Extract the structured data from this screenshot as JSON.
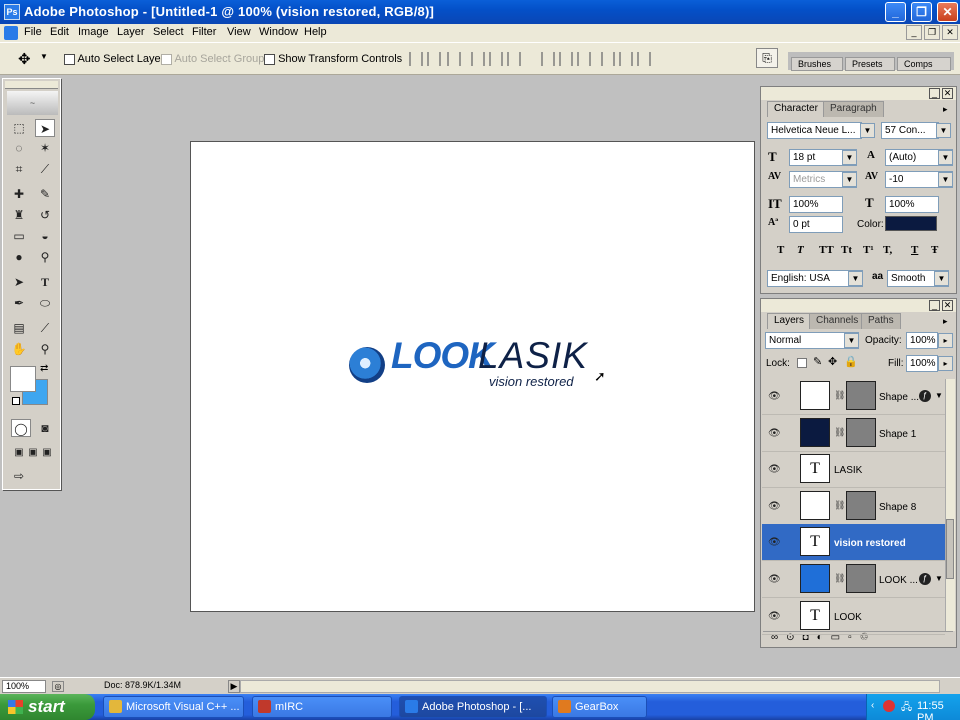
{
  "window": {
    "title": "Adobe Photoshop - [Untitled-1 @ 100% (vision restored, RGB/8)]",
    "app_icon": "Ps",
    "minimize": "_",
    "restore": "❐",
    "close": "✕"
  },
  "menu": {
    "items": [
      "File",
      "Edit",
      "Image",
      "Layer",
      "Select",
      "Filter",
      "View",
      "Window",
      "Help"
    ],
    "doc_minimize": "_",
    "doc_restore": "❐",
    "doc_close": "✕"
  },
  "options_bar": {
    "auto_select_layer": "Auto Select Layer",
    "auto_select_groups": "Auto Select Groups",
    "show_transform_controls": "Show Transform Controls",
    "well_tabs": [
      "Brushes",
      "Presets",
      "Comps"
    ]
  },
  "document": {
    "logo": {
      "look": "LOOK",
      "lasik": "LASIK",
      "tagline": "vision restored"
    }
  },
  "character_panel": {
    "tabs": [
      "Character",
      "Paragraph"
    ],
    "font_family": "Helvetica Neue L...",
    "font_style": "57 Con...",
    "size": "18 pt",
    "leading": "(Auto)",
    "kerning": "Metrics",
    "tracking": "-10",
    "vertical_scale": "100%",
    "horizontal_scale": "100%",
    "baseline_shift": "0 pt",
    "color_label": "Color:",
    "color": "#0b1a40",
    "style_buttons": [
      "T",
      "T",
      "TT",
      "Tt",
      "T¹",
      "T,",
      "T",
      "Ŧ"
    ],
    "language": "English: USA",
    "antialias_icon": "aa",
    "antialias": "Smooth"
  },
  "layers_panel": {
    "tabs": [
      "Layers",
      "Channels",
      "Paths"
    ],
    "blend_mode": "Normal",
    "opacity_label": "Opacity:",
    "opacity": "100%",
    "lock_label": "Lock:",
    "fill_label": "Fill:",
    "fill": "100%",
    "layers": [
      {
        "name": "Shape ...",
        "type": "shape",
        "thumb": "#ffffff",
        "fx": true,
        "selected": false
      },
      {
        "name": "Shape 1",
        "type": "shape",
        "thumb": "#0b1a40",
        "fx": false,
        "selected": false
      },
      {
        "name": "LASIK",
        "type": "text",
        "fx": false,
        "selected": false
      },
      {
        "name": "Shape 8",
        "type": "shape",
        "thumb": "#ffffff",
        "fx": false,
        "selected": false
      },
      {
        "name": "vision restored",
        "type": "text",
        "fx": false,
        "selected": true
      },
      {
        "name": "LOOK ...",
        "type": "shape",
        "thumb": "#1f6fd8",
        "fx": true,
        "selected": false
      },
      {
        "name": "LOOK",
        "type": "text",
        "fx": false,
        "selected": false
      }
    ]
  },
  "status_bar": {
    "zoom": "100%",
    "doc_info": "Doc: 878.9K/1.34M"
  },
  "taskbar": {
    "start": "start",
    "tasks": [
      {
        "label": "Microsoft Visual C++ ...",
        "color": "#e3b73b",
        "active": false
      },
      {
        "label": "mIRC",
        "color": "#c0392b",
        "active": false
      },
      {
        "label": "Adobe Photoshop - [...",
        "color": "#2a7be8",
        "active": true
      },
      {
        "label": "GearBox",
        "color": "#e07a1f",
        "active": false
      }
    ],
    "clock": "11:55 PM"
  }
}
